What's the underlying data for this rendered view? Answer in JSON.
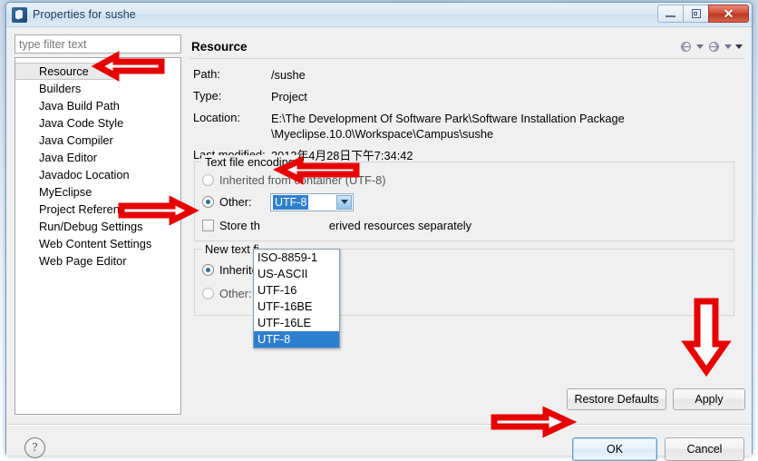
{
  "window": {
    "title": "Properties for sushe",
    "icon": "properties-window-icon",
    "controls": {
      "minimize": "minimize-button",
      "restore": "restore-button",
      "close": "close-button"
    }
  },
  "sidebar": {
    "filter_placeholder": "type filter text",
    "filter_value": "",
    "items": [
      {
        "label": "Resource",
        "selected": true
      },
      {
        "label": "Builders",
        "selected": false
      },
      {
        "label": "Java Build Path",
        "selected": false
      },
      {
        "label": "Java Code Style",
        "selected": false
      },
      {
        "label": "Java Compiler",
        "selected": false
      },
      {
        "label": "Java Editor",
        "selected": false
      },
      {
        "label": "Javadoc Location",
        "selected": false
      },
      {
        "label": "MyEclipse",
        "selected": false
      },
      {
        "label": "Project References",
        "selected": false
      },
      {
        "label": "Run/Debug Settings",
        "selected": false
      },
      {
        "label": "Web Content Settings",
        "selected": false
      },
      {
        "label": "Web Page Editor",
        "selected": false
      }
    ]
  },
  "page": {
    "title": "Resource",
    "nav": {
      "back": "back-arrow-icon",
      "back_menu": "back-dropdown-icon",
      "forward": "forward-arrow-icon",
      "forward_menu": "forward-dropdown-icon",
      "view_menu": "view-menu-icon"
    },
    "info": [
      {
        "label": "Path:",
        "value": "/sushe"
      },
      {
        "label": "Type:",
        "value": "Project"
      },
      {
        "label": "Location:",
        "value": "E:\\The Development Of Software Park\\Software Installation Package\n\\Myeclipse.10.0\\Workspace\\Campus\\sushe"
      },
      {
        "label": "Last modified:",
        "value": "2013年4月28日下午7:34:42"
      }
    ],
    "encoding_group": {
      "legend": "Text file encoding",
      "inherited": {
        "label": "Inherited from container (UTF-8)",
        "checked": false
      },
      "other": {
        "label": "Other:",
        "checked": true,
        "value": "UTF-8"
      },
      "store_checkbox": {
        "label_before": "Store th",
        "label_after": "erived resources separately",
        "full_label": "Store the encoding of derived resources separately",
        "checked": false
      }
    },
    "dropdown": {
      "open": true,
      "options": [
        {
          "label": "ISO-8859-1",
          "selected": false
        },
        {
          "label": "US-ASCII",
          "selected": false
        },
        {
          "label": "UTF-16",
          "selected": false
        },
        {
          "label": "UTF-16BE",
          "selected": false
        },
        {
          "label": "UTF-16LE",
          "selected": false
        },
        {
          "label": "UTF-8",
          "selected": true
        }
      ]
    },
    "newfile_group": {
      "legend_visible": "New text fi",
      "legend": "New text file line delimiter",
      "inherited": {
        "label_visible": "Inherite",
        "label": "Inherited from container (Windows)",
        "checked": true
      },
      "other": {
        "label": "Other:",
        "checked": false
      }
    },
    "buttons": {
      "restore_defaults": "Restore Defaults",
      "apply": "Apply"
    }
  },
  "footer": {
    "help": "?",
    "ok": "OK",
    "cancel": "Cancel"
  },
  "annotations": [
    {
      "name": "arrow-pointing-to-resource",
      "direction": "left",
      "color": "#e60000"
    },
    {
      "name": "arrow-pointing-to-other-radio",
      "direction": "right",
      "color": "#e60000"
    },
    {
      "name": "arrow-pointing-to-text-file-encoding",
      "direction": "left",
      "color": "#e60000"
    },
    {
      "name": "arrow-pointing-to-apply",
      "direction": "down",
      "color": "#e60000"
    },
    {
      "name": "arrow-pointing-to-ok",
      "direction": "right",
      "color": "#e60000"
    }
  ],
  "colors": {
    "accent": "#2f7fd0",
    "annotation": "#e60000",
    "titlebar": "#dceaf6",
    "dialog_bg": "#f0f0f0"
  }
}
